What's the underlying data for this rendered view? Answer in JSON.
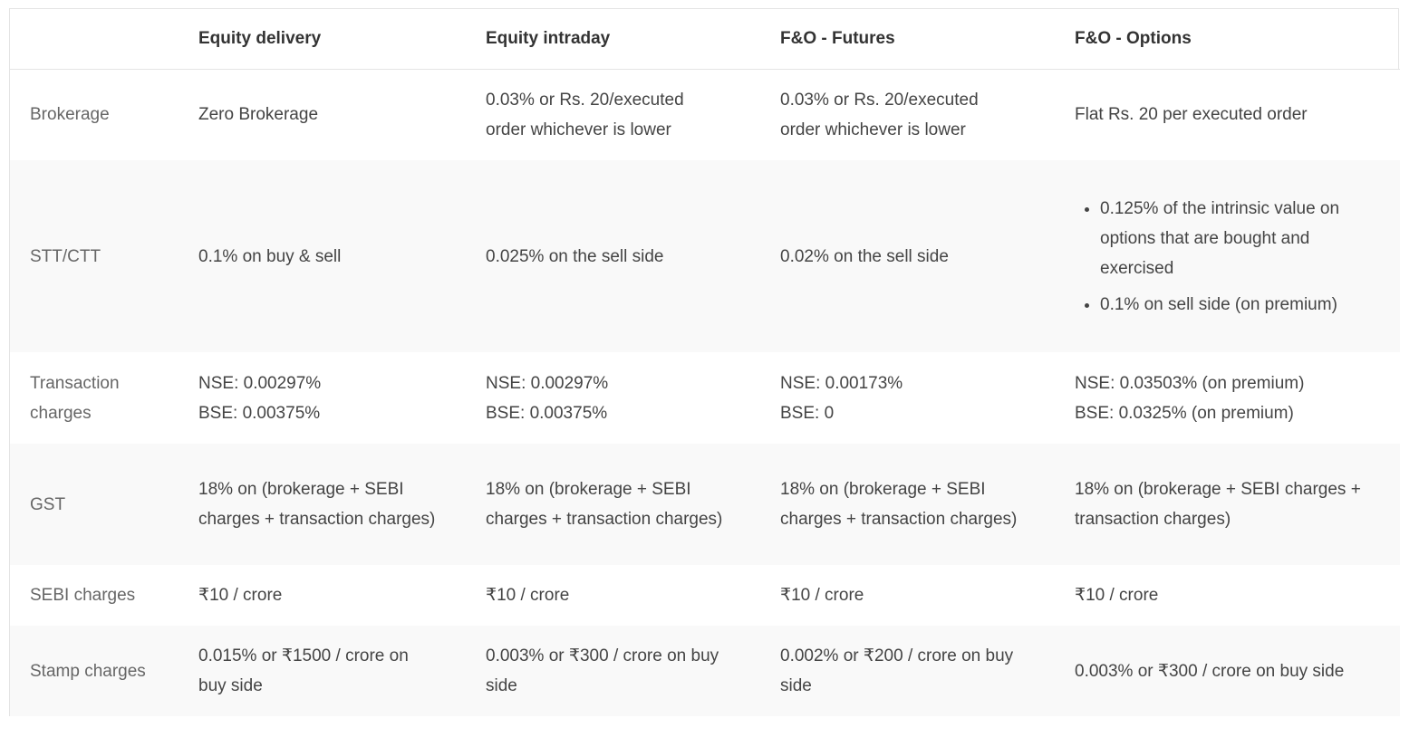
{
  "table": {
    "headers": [
      "",
      "Equity delivery",
      "Equity intraday",
      "F&O - Futures",
      "F&O - Options"
    ],
    "rows": {
      "brokerage": {
        "label": "Brokerage",
        "delivery": "Zero Brokerage",
        "intraday": "0.03% or Rs. 20/executed order whichever is lower",
        "futures": "0.03% or Rs. 20/executed order whichever is lower",
        "options": "Flat Rs. 20 per executed order"
      },
      "stt": {
        "label": "STT/CTT",
        "delivery": "0.1% on buy & sell",
        "intraday": "0.025% on the sell side",
        "futures": "0.02% on the sell side",
        "options": [
          "0.125% of the intrinsic value on options that are bought and exercised",
          "0.1% on sell side (on premium)"
        ]
      },
      "transaction": {
        "label": "Transaction charges",
        "delivery": [
          "NSE: 0.00297%",
          "BSE: 0.00375%"
        ],
        "intraday": [
          "NSE: 0.00297%",
          "BSE: 0.00375%"
        ],
        "futures": [
          "NSE: 0.00173%",
          "BSE: 0"
        ],
        "options": [
          "NSE: 0.03503% (on premium)",
          "BSE: 0.0325% (on premium)"
        ]
      },
      "gst": {
        "label": "GST",
        "delivery": "18% on (brokerage + SEBI charges + transaction charges)",
        "intraday": "18% on (brokerage + SEBI charges + transaction charges)",
        "futures": "18% on (brokerage + SEBI charges + transaction charges)",
        "options": "18% on (brokerage + SEBI charges + transaction charges)"
      },
      "sebi": {
        "label": "SEBI charges",
        "delivery": "₹10 / crore",
        "intraday": "₹10 / crore",
        "futures": "₹10 / crore",
        "options": "₹10 / crore"
      },
      "stamp": {
        "label": "Stamp charges",
        "delivery": "0.015% or ₹1500 / crore on buy side",
        "intraday": "0.003% or ₹300 / crore on buy side",
        "futures": "0.002% or ₹200 / crore on buy side",
        "options": "0.003% or ₹300 / crore on buy side"
      }
    }
  }
}
